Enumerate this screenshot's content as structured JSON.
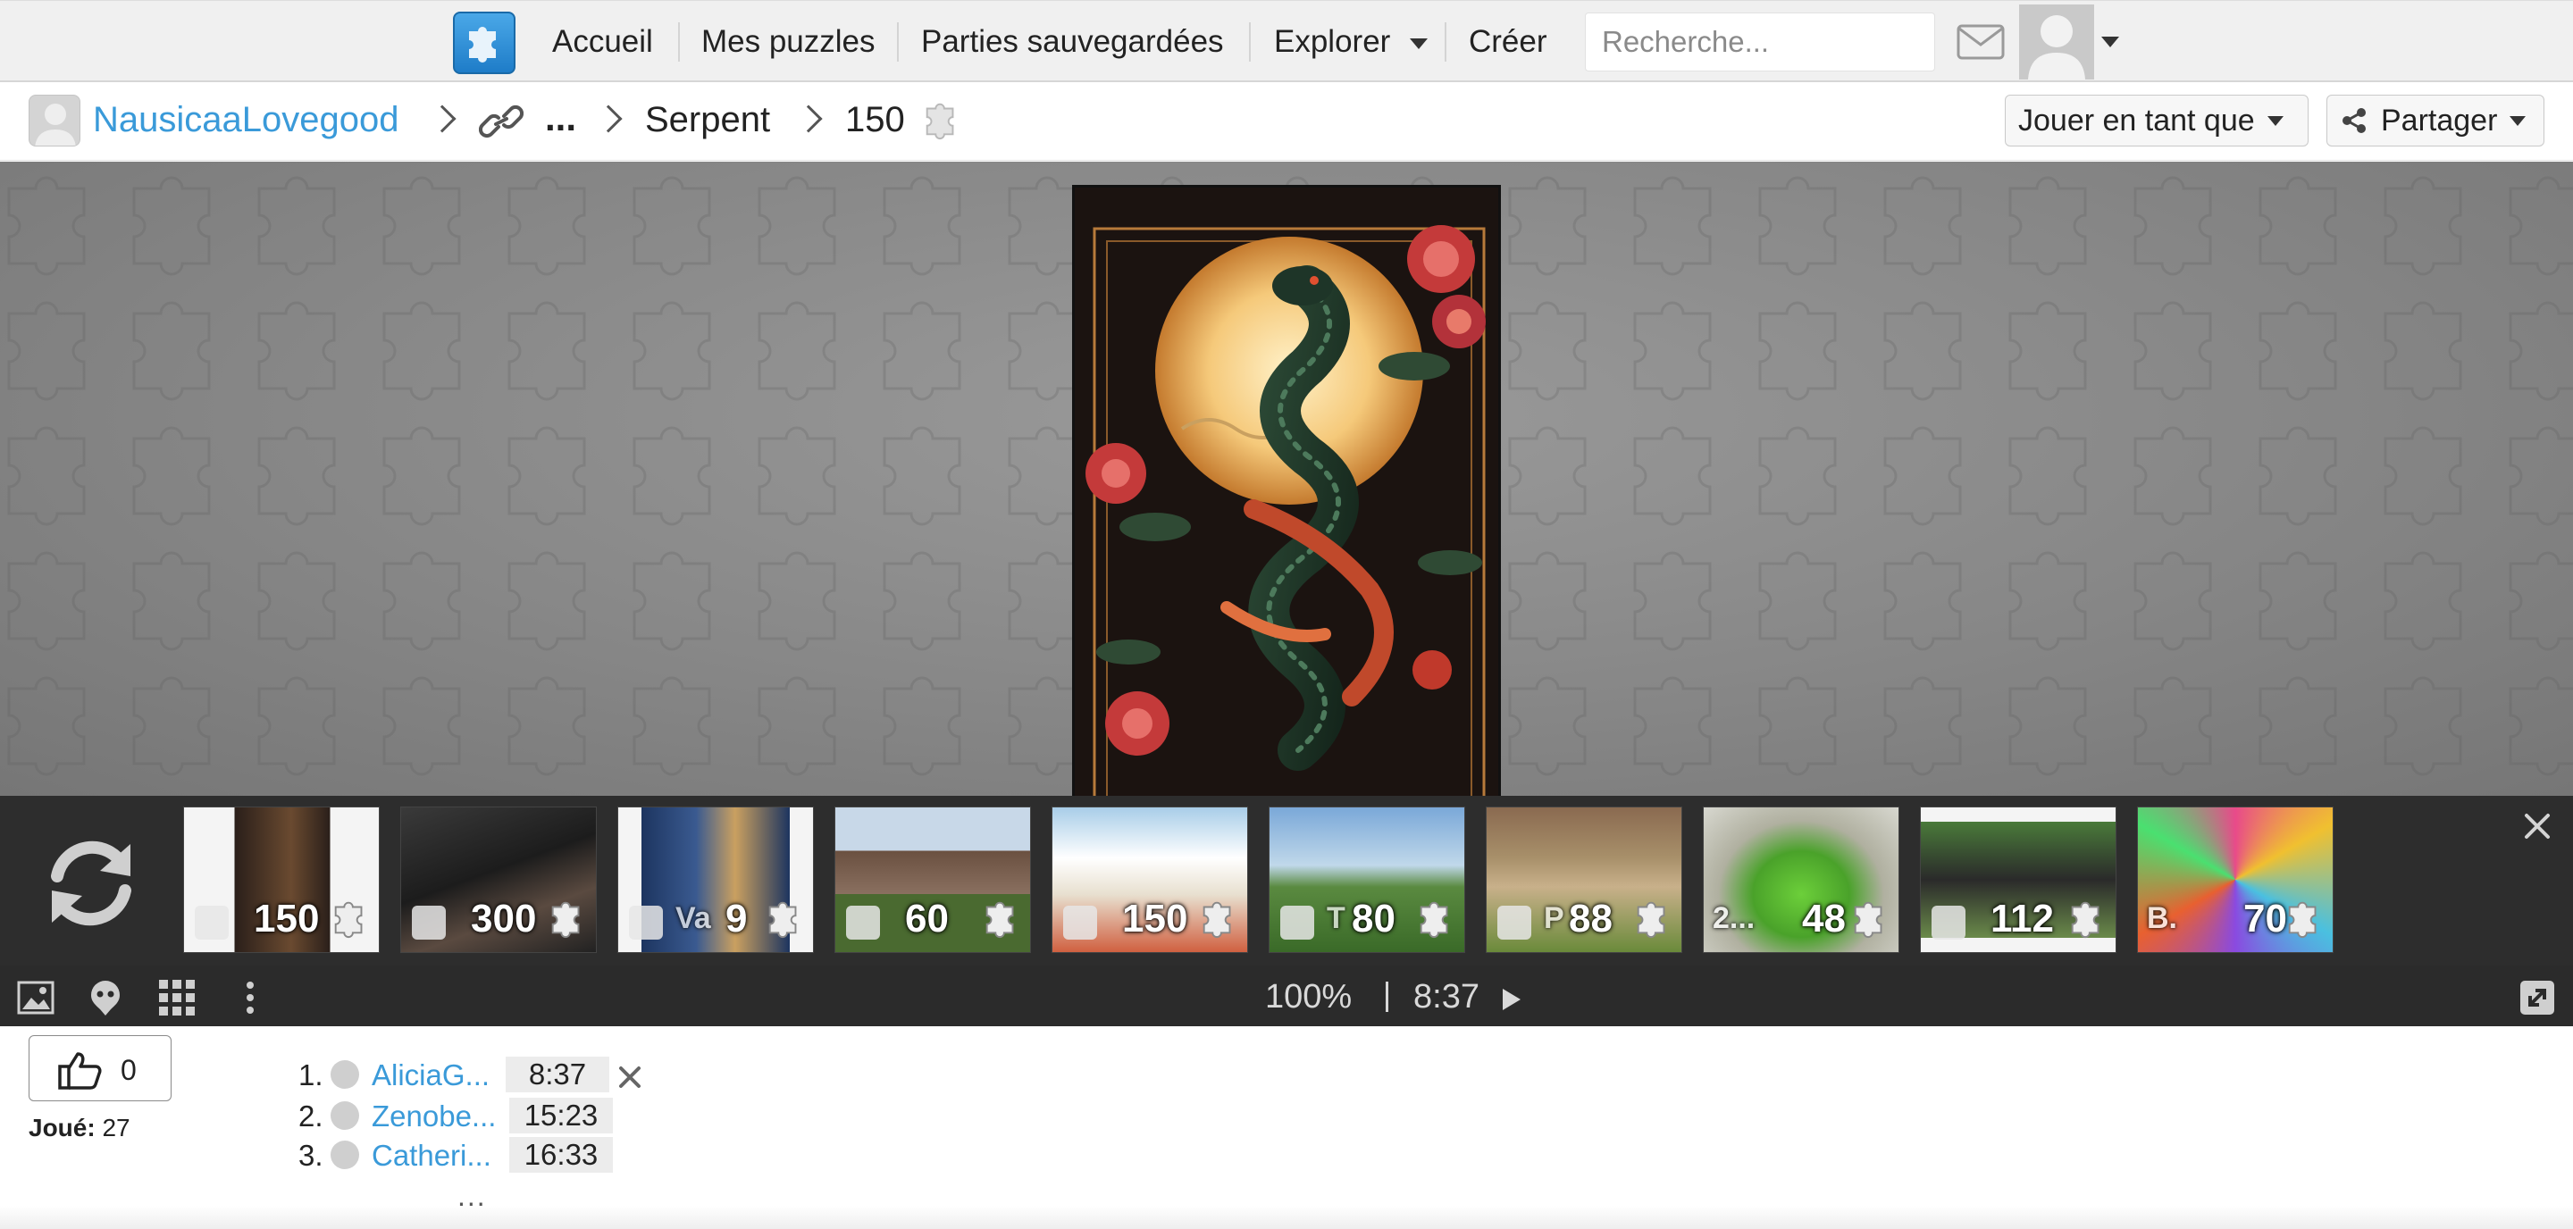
{
  "nav": {
    "items": [
      {
        "label": "Accueil"
      },
      {
        "label": "Mes puzzles"
      },
      {
        "label": "Parties sauvegardées"
      },
      {
        "label": "Explorer"
      },
      {
        "label": "Créer"
      }
    ],
    "search_placeholder": "Recherche...",
    "icons": {
      "logo": "puzzle-logo-icon",
      "mail": "mail-icon",
      "avatar": "user-avatar-icon"
    }
  },
  "breadcrumb": {
    "user": "NausicaaLovegood",
    "ellipsis": "...",
    "category": "Serpent",
    "pieces": "150"
  },
  "actions": {
    "play_as": "Jouer en tant que",
    "share": "Partager"
  },
  "carousel": {
    "items": [
      {
        "count": "150"
      },
      {
        "count": "300"
      },
      {
        "count": "9",
        "overlay": "Va"
      },
      {
        "count": "60"
      },
      {
        "count": "150"
      },
      {
        "count": "80",
        "overlay": "T"
      },
      {
        "count": "88",
        "overlay": "P"
      },
      {
        "count": "48",
        "overlay": "2..."
      },
      {
        "count": "112"
      },
      {
        "count": "70",
        "overlay": "B."
      }
    ]
  },
  "status": {
    "zoom": "100%",
    "timer": "8:37"
  },
  "bottom": {
    "likes": "0",
    "played_label": "Joué:",
    "played_count": "27",
    "more": "...",
    "leaderboard": [
      {
        "rank": "1.",
        "name": "AliciaG...",
        "time": "8:37"
      },
      {
        "rank": "2.",
        "name": "Zenobe...",
        "time": "15:23"
      },
      {
        "rank": "3.",
        "name": "Catheri...",
        "time": "16:33"
      }
    ]
  },
  "colors": {
    "link": "#3a9ad9",
    "nav_bg": "#f0f0f0",
    "stage_bg": "#878787",
    "carousel_bg": "#262626",
    "statusbar_bg": "#2b2b2b"
  }
}
